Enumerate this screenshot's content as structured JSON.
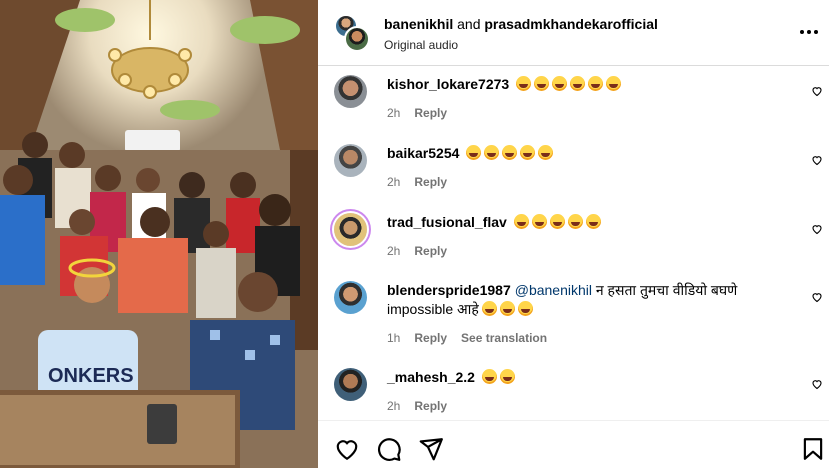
{
  "header": {
    "user1": "banenikhil",
    "connector": "and",
    "user2": "prasadmkhandekarofficial",
    "audio": "Original audio"
  },
  "comments": [
    {
      "user": "kishor_lokare7273",
      "text": "",
      "emoji_count": 6,
      "time": "2h",
      "reply": "Reply",
      "translate": ""
    },
    {
      "user": "baikar5254",
      "text": "",
      "emoji_count": 5,
      "time": "2h",
      "reply": "Reply",
      "translate": ""
    },
    {
      "user": "trad_fusional_flav",
      "text": "",
      "emoji_count": 5,
      "time": "2h",
      "reply": "Reply",
      "translate": ""
    },
    {
      "user": "blenderspride1987",
      "mention": "@banenikhil",
      "text": " न हसता तुमचा वीडियो बघणे impossible आहे",
      "emoji_count": 3,
      "time": "1h",
      "reply": "Reply",
      "translate": "See translation"
    },
    {
      "user": "_mahesh_2.2",
      "text": "",
      "emoji_count": 2,
      "time": "2h",
      "reply": "Reply",
      "translate": ""
    }
  ],
  "media": {
    "shirt_text": "ONKERS"
  },
  "icons": [
    "more-icon",
    "heart-icon",
    "like-icon",
    "comment-icon",
    "share-icon",
    "save-icon",
    "laughing-emoji"
  ],
  "colors": {
    "mention": "#00376b",
    "meta": "#737373",
    "border": "#dbdbdb"
  }
}
